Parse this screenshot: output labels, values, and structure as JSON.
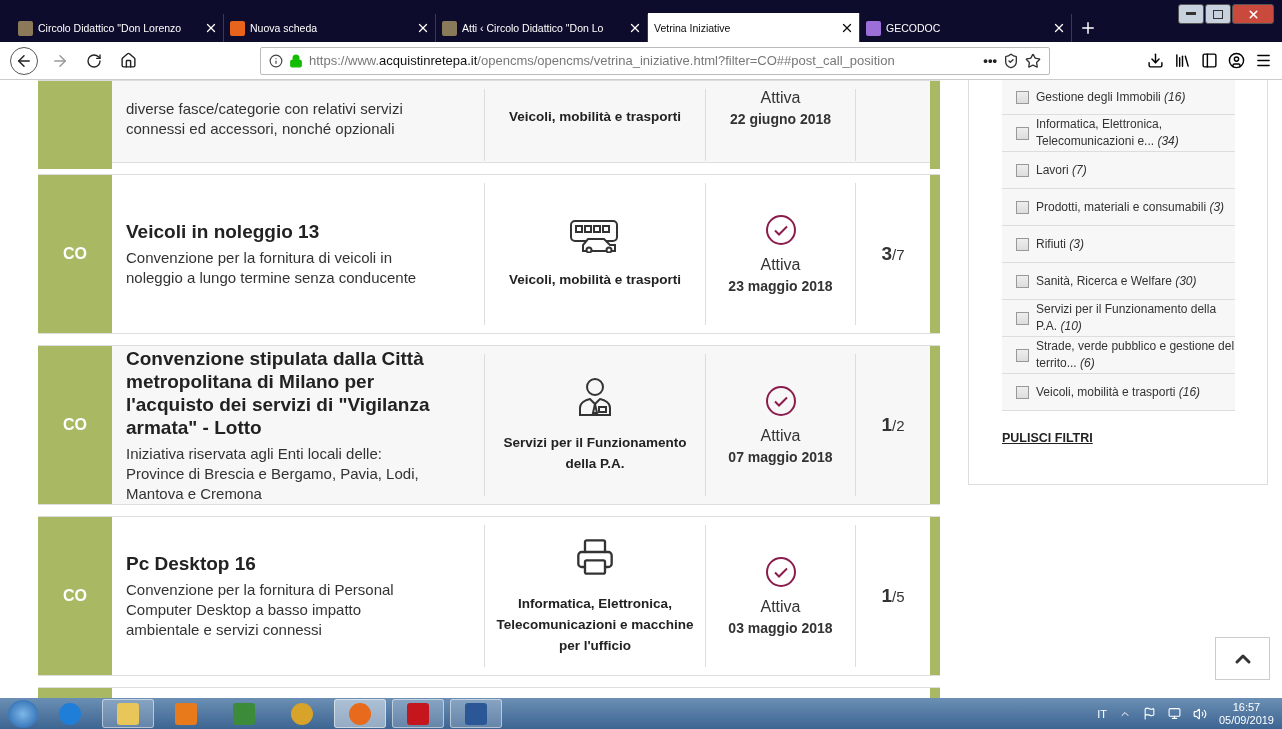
{
  "browser": {
    "tabs": [
      {
        "title": "Circolo Didattico \"Don Lorenzo",
        "selected": false
      },
      {
        "title": "Nuova scheda",
        "selected": false
      },
      {
        "title": "Atti ‹ Circolo Didattico \"Don Lo",
        "selected": false
      },
      {
        "title": "Vetrina Iniziative",
        "selected": true
      },
      {
        "title": "GECODOC",
        "selected": false
      }
    ],
    "url": {
      "prefix": "https://www.",
      "domain": "acquistinretepa.it",
      "path": "/opencms/opencms/vetrina_iniziative.html?filter=CO##post_call_position"
    },
    "page_actions": "•••"
  },
  "cards": [
    {
      "kind": "partial",
      "description": "diverse fasce/categorie con relativi servizi connessi ed accessori, nonché opzionali",
      "category": "Veicoli, mobilità e trasporti",
      "status": "Attiva",
      "date": "22 giugno 2018"
    },
    {
      "kind": "full",
      "badge": "CO",
      "title": "Veicoli in noleggio 13",
      "description": "Convenzione per la fornitura di veicoli in noleggio a lungo termine senza conducente",
      "category": "Veicoli, mobilità e trasporti",
      "status": "Attiva",
      "date": "23 maggio 2018",
      "count": "3",
      "total": "/7"
    },
    {
      "kind": "full",
      "badge": "CO",
      "title": "Convenzione stipulata dalla Città metropolitana di Milano per l'acquisto dei servizi di \"Vigilanza armata\" - Lotto",
      "description": "Iniziativa riservata agli Enti locali delle: Province di Brescia e Bergamo, Pavia, Lodi, Mantova e Cremona",
      "category": "Servizi per il Funzionamento della P.A.",
      "status": "Attiva",
      "date": "07 maggio 2018",
      "count": "1",
      "total": "/2"
    },
    {
      "kind": "full",
      "badge": "CO",
      "title": "Pc Desktop 16",
      "description": "Convenzione per la fornitura di Personal Computer Desktop a basso impatto ambientale e servizi connessi",
      "category": "Informatica, Elettronica, Telecomunicazioni e macchine per l'ufficio",
      "status": "Attiva",
      "date": "03 maggio 2018",
      "count": "1",
      "total": "/5"
    },
    {
      "kind": "empty"
    }
  ],
  "filters": {
    "items": [
      {
        "label": "Gestione degli Immobili",
        "count": "(16)",
        "checked": false
      },
      {
        "label": "Informatica, Elettronica, Telecomunicazioni e...",
        "count": "(34)",
        "checked": false
      },
      {
        "label": "Lavori",
        "count": "(7)",
        "checked": false
      },
      {
        "label": "Prodotti, materiali e consumabili",
        "count": "(3)",
        "checked": false
      },
      {
        "label": "Rifiuti",
        "count": "(3)",
        "checked": false
      },
      {
        "label": "Sanità, Ricerca e Welfare",
        "count": "(30)",
        "checked": false
      },
      {
        "label": "Servizi per il Funzionamento della P.A.",
        "count": "(10)",
        "checked": false
      },
      {
        "label": "Strade, verde pubblico e gestione del territo...",
        "count": "(6)",
        "checked": false
      },
      {
        "label": "Veicoli, mobilità e trasporti",
        "count": "(16)",
        "checked": false
      }
    ],
    "clear": "PULISCI FILTRI"
  },
  "taskbar": {
    "apps": [
      {
        "kind": "ie",
        "open": false,
        "selected": false
      },
      {
        "kind": "folder",
        "open": true,
        "selected": false
      },
      {
        "kind": "media",
        "open": false,
        "selected": false
      },
      {
        "kind": "green",
        "open": false,
        "selected": false
      },
      {
        "kind": "chrome",
        "open": false,
        "selected": false
      },
      {
        "kind": "firefox",
        "open": true,
        "selected": true
      },
      {
        "kind": "pdf",
        "open": true,
        "selected": false
      },
      {
        "kind": "word",
        "open": true,
        "selected": false
      }
    ],
    "language": "IT",
    "time": "16:57",
    "date": "05/09/2019"
  }
}
